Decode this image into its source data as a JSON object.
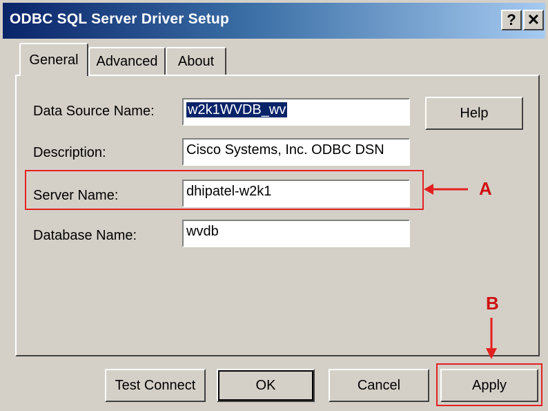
{
  "window": {
    "title": "ODBC SQL Server Driver Setup",
    "help_glyph": "?",
    "close_glyph": "✕"
  },
  "tabs": [
    {
      "label": "General",
      "active": true
    },
    {
      "label": "Advanced",
      "active": false
    },
    {
      "label": "About",
      "active": false
    }
  ],
  "form": {
    "dsn": {
      "label": "Data Source Name:",
      "value": "w2k1WVDB_wv"
    },
    "description": {
      "label": "Description:",
      "value": "Cisco Systems, Inc. ODBC DSN"
    },
    "server": {
      "label": "Server Name:",
      "value": "dhipatel-w2k1"
    },
    "database": {
      "label": "Database Name:",
      "value": "wvdb"
    }
  },
  "buttons": {
    "help": "Help",
    "test_connect": "Test Connect",
    "ok": "OK",
    "cancel": "Cancel",
    "apply": "Apply"
  },
  "annotations": {
    "a_label": "A",
    "b_label": "B",
    "color": "#e32020"
  }
}
